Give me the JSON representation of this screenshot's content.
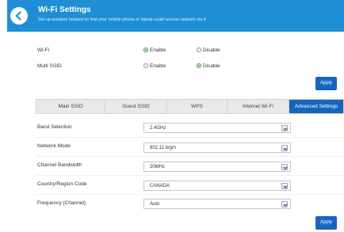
{
  "header": {
    "title": "Wi-Fi Settings",
    "subtitle": "Set up wireless hotspot so that your mobile phone or laptop could access network via it"
  },
  "wifi": {
    "label": "Wi-Fi",
    "enable_label": "Enable",
    "disable_label": "Disable",
    "selected": "Enable"
  },
  "multi_ssid": {
    "label": "Multi SSID",
    "enable_label": "Enable",
    "disable_label": "Disable",
    "selected": "Disable"
  },
  "apply_label": "Apply",
  "tabs": [
    {
      "label": "Main SSID"
    },
    {
      "label": "Guest SSID"
    },
    {
      "label": "WPS"
    },
    {
      "label": "Internet Wi-Fi"
    },
    {
      "label": "Advanced Settings"
    }
  ],
  "active_tab": "Advanced Settings",
  "settings": [
    {
      "label": "Band Selection",
      "value": "2.4GHz"
    },
    {
      "label": "Network Mode",
      "value": "802.11 b/g/n"
    },
    {
      "label": "Channel Bandwidth",
      "value": "20MHz"
    },
    {
      "label": "Country/Region Code",
      "value": "CANADA"
    },
    {
      "label": "Frequency (Channel)",
      "value": "Auto"
    }
  ],
  "colors": {
    "header": "#1e8fd5",
    "accent": "#1565c0",
    "radio_selected": "#2c8a2c"
  }
}
